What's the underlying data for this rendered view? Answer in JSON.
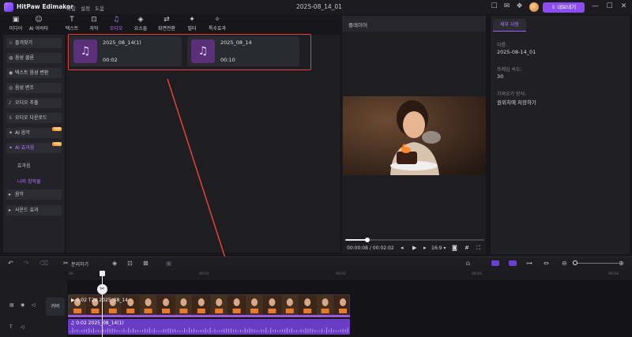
{
  "app": {
    "name": "HitPaw Edimakor",
    "menus": [
      "파일",
      "설정",
      "도움"
    ],
    "doc_title": "2025-08_14_01",
    "export_label": "내보내기"
  },
  "toolbar": [
    {
      "label": "미디어",
      "icon": "media-icon"
    },
    {
      "label": "AI 아바타",
      "icon": "avatar-icon"
    },
    {
      "label": "텍스트",
      "icon": "text-icon"
    },
    {
      "label": "자막",
      "icon": "subtitle-icon"
    },
    {
      "label": "오디오",
      "icon": "audio-icon",
      "active": true
    },
    {
      "label": "요소들",
      "icon": "elements-icon"
    },
    {
      "label": "화면전환",
      "icon": "transition-icon"
    },
    {
      "label": "필터",
      "icon": "filter-icon"
    },
    {
      "label": "특수효과",
      "icon": "effects-icon"
    }
  ],
  "sidebar": {
    "items": [
      "즐겨찾기",
      "음성 클론",
      "텍스트 음성 변환",
      "음성 변조",
      "오디오 추출",
      "오디오 다운로드",
      "AI 음악",
      "AI 효과음"
    ],
    "sub_items": [
      "효과음",
      "나의 창작물"
    ],
    "groups": [
      "음악",
      "사운드 효과"
    ],
    "new_badge": "NEW"
  },
  "media": {
    "cards": [
      {
        "name": "2025_08_14(1)",
        "duration": "00:02"
      },
      {
        "name": "2025_08_14",
        "duration": "00:10"
      }
    ]
  },
  "player": {
    "label": "플레이어",
    "time": "00:00:08 / 00:02:02",
    "ratio": "16:9",
    "progress": 0.16
  },
  "details": {
    "tab": "세부 사항",
    "fields": [
      {
        "label": "이름:",
        "value": "2025-08-14_01"
      },
      {
        "label": "프레임 속도:",
        "value": "30"
      },
      {
        "label": "가져오기 방식:",
        "value": "원위치에 저장하기"
      }
    ]
  },
  "timeline": {
    "split_label": "분리하기",
    "ticks": [
      "00",
      "00:01",
      "00:02",
      "00:03",
      "00:04"
    ],
    "cover_label": "커버",
    "video_clip_label": "0:02  T2V  2025_08_14",
    "audio_clip_label": "0:02  2025_08_14(1)"
  },
  "colors": {
    "accent": "#8c4df2",
    "highlight": "#e8403c",
    "audio_clip": "#6a3cc4"
  }
}
